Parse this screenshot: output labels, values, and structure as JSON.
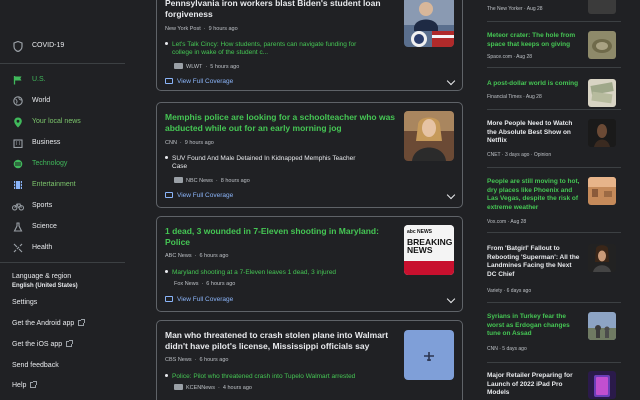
{
  "sidebar": {
    "covid": "COVID-19",
    "items": [
      {
        "label": "U.S."
      },
      {
        "label": "World"
      },
      {
        "label": "Your local news"
      },
      {
        "label": "Business"
      },
      {
        "label": "Technology"
      },
      {
        "label": "Entertainment"
      },
      {
        "label": "Sports"
      },
      {
        "label": "Science"
      },
      {
        "label": "Health"
      }
    ],
    "language_label": "Language & region",
    "language_value": "English (United States)",
    "settings": "Settings",
    "android": "Get the Android app",
    "ios": "Get the iOS app",
    "feedback": "Send feedback",
    "help": "Help"
  },
  "cards": [
    {
      "headline_1": "Pennsylvania iron workers blast Biden's student loan",
      "headline_2": "forgiveness",
      "source": "New York Post",
      "time": "9 hours ago",
      "sub_1": "Let's Talk Cincy: How students, parents can navigate funding for",
      "sub_2": "college in wake of the student c...",
      "sub_source": "WLWT",
      "sub_time": "5 hours ago",
      "coverage": "View Full Coverage"
    },
    {
      "headline_1": "Memphis police are looking for a schoolteacher who was",
      "headline_2": "abducted while out for an early morning jog",
      "source": "CNN",
      "time": "9 hours ago",
      "sub_1": "SUV Found And Male Detained In Kidnapped Memphis Teacher",
      "sub_2": "Case",
      "sub_source": "NBC News",
      "sub_time": "8 hours ago",
      "coverage": "View Full Coverage"
    },
    {
      "headline_1": "1 dead, 3 wounded in 7-Eleven shooting in Maryland:",
      "headline_2": "Police",
      "source": "ABC News",
      "time": "6 hours ago",
      "sub_1": "Maryland shooting at a 7-Eleven leaves 1 dead, 3 injured",
      "sub_source": "Fox News",
      "sub_time": "6 hours ago",
      "coverage": "View Full Coverage",
      "thumb_text_1": "abc NEWS",
      "thumb_text_2": "BREAKING",
      "thumb_text_3": "NEWS"
    },
    {
      "headline_1": "Man who threatened to crash stolen plane into Walmart",
      "headline_2": "didn't have pilot's license, Mississippi officials say",
      "source": "CBS News",
      "time": "6 hours ago",
      "sub_1": "Police: Pilot who threatened crash into Tupelo Walmart arrested",
      "sub_source": "KCENNews",
      "sub_time": "4 hours ago"
    }
  ],
  "right": [
    {
      "meta": "The New Yorker  ·  Aug 28"
    },
    {
      "title_1": "Meteor crater: The hole from",
      "title_2": "space that keeps on giving",
      "meta": "Space.com  ·  Aug 28"
    },
    {
      "title_1": "A post-dollar world is coming",
      "meta": "Financial Times  ·  Aug 28"
    },
    {
      "title_1": "More People Need to Watch",
      "title_2": "the Absolute Best Show on",
      "title_3": "Netflix",
      "meta": "CNET  ·  3 days ago  ·  Opinion"
    },
    {
      "title_1": "People are still moving to hot,",
      "title_2": "dry places like Phoenix and",
      "title_3": "Las Vegas, despite the risk of",
      "title_4": "extreme weather",
      "meta": "Vox.com  ·  Aug 28"
    },
    {
      "title_1": "From 'Batgirl' Fallout to",
      "title_2": "Rebooting 'Superman': All the",
      "title_3": "Landmines Facing the Next",
      "title_4": "DC Chief",
      "meta": "Variety  ·  6 days ago"
    },
    {
      "title_1": "Syrians in Turkey fear the",
      "title_2": "worst as Erdogan changes",
      "title_3": "tune on Assad",
      "meta": "CNN  ·  5 days ago"
    },
    {
      "title_1": "Major Retailer Preparing for",
      "title_2": "Launch of 2022 iPad Pro",
      "title_3": "Models"
    }
  ]
}
